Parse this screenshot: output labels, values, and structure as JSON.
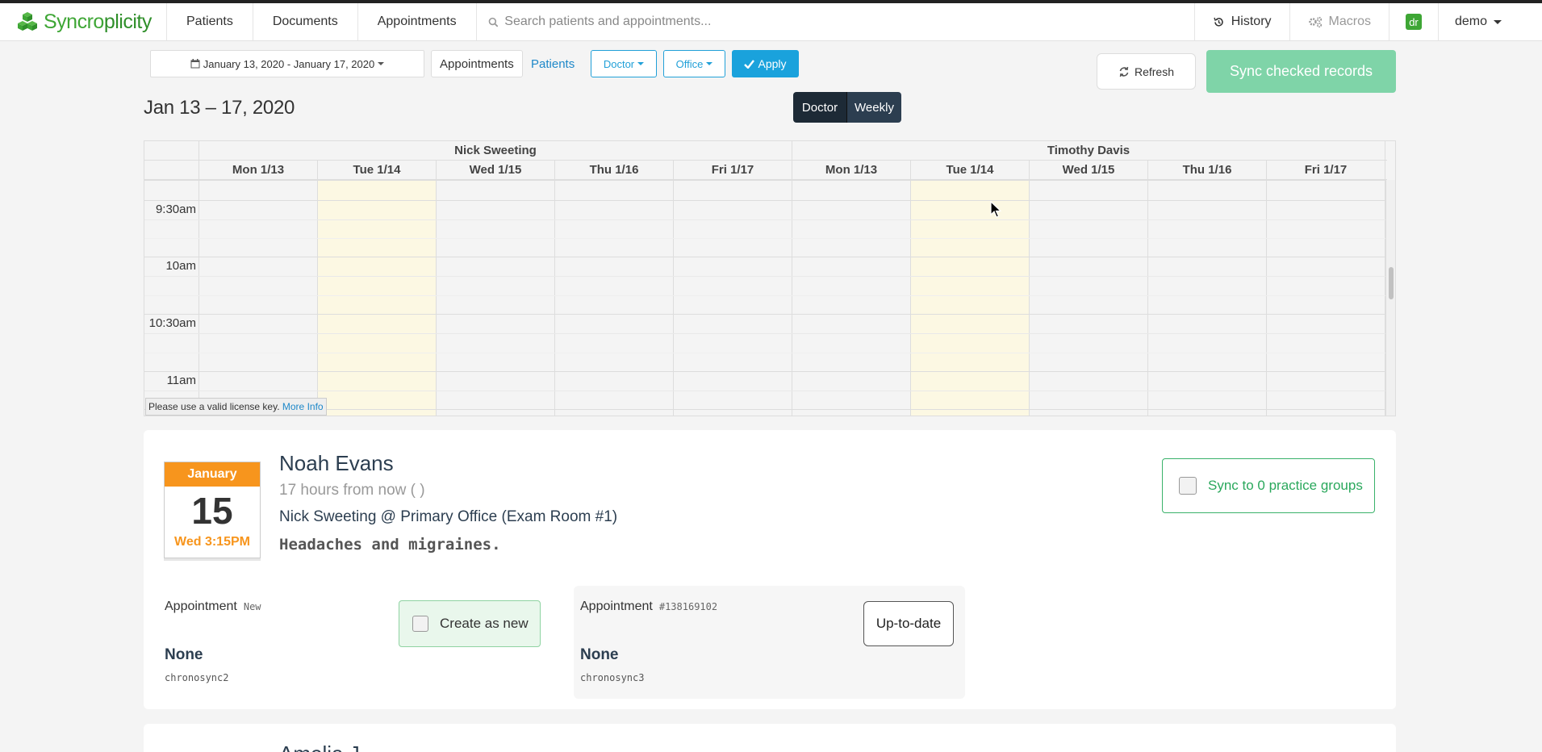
{
  "navbar": {
    "brand_a": "Syncro",
    "brand_b": "plicity",
    "items": [
      "Patients",
      "Documents",
      "Appointments"
    ],
    "search_placeholder": "Search patients and appointments...",
    "history": "History",
    "macros": "Macros",
    "badge": "dr",
    "user": "demo"
  },
  "toolbar": {
    "date_range": "January 13, 2020 - January 17, 2020",
    "tab_appointments": "Appointments",
    "tab_patients": "Patients",
    "doctor": "Doctor",
    "office": "Office",
    "apply": "Apply",
    "refresh": "Refresh",
    "sync": "Sync checked records"
  },
  "range_title": "Jan 13 – 17, 2020",
  "view": {
    "doctor": "Doctor",
    "weekly": "Weekly"
  },
  "calendar": {
    "resources": [
      "Nick Sweeting",
      "Timothy Davis"
    ],
    "days": [
      "Mon 1/13",
      "Tue 1/14",
      "Wed 1/15",
      "Thu 1/16",
      "Fri 1/17",
      "Mon 1/13",
      "Tue 1/14",
      "Wed 1/15",
      "Thu 1/16",
      "Fri 1/17"
    ],
    "times": [
      "9:30am",
      "10am",
      "10:30am",
      "11am"
    ],
    "license_text": "Please use a valid license key.",
    "license_link": "More Info"
  },
  "appointment": {
    "month": "January",
    "day": "15",
    "when": "Wed 3:15PM",
    "patient": "Noah Evans",
    "relative": "17 hours from now ( )",
    "doctor_line": "Nick Sweeting @ Primary Office (Exam Room #1)",
    "reason": "Headaches and migraines.",
    "sync_groups": "Sync to 0 practice groups",
    "left": {
      "label": "Appointment",
      "tag": "New",
      "value": "None",
      "system": "chronosync2",
      "action": "Create as new"
    },
    "right": {
      "label": "Appointment",
      "tag": "#138169102",
      "value": "None",
      "system": "chronosync3",
      "action": "Up-to-date"
    }
  },
  "next_patient_partial": "Amelia J..."
}
